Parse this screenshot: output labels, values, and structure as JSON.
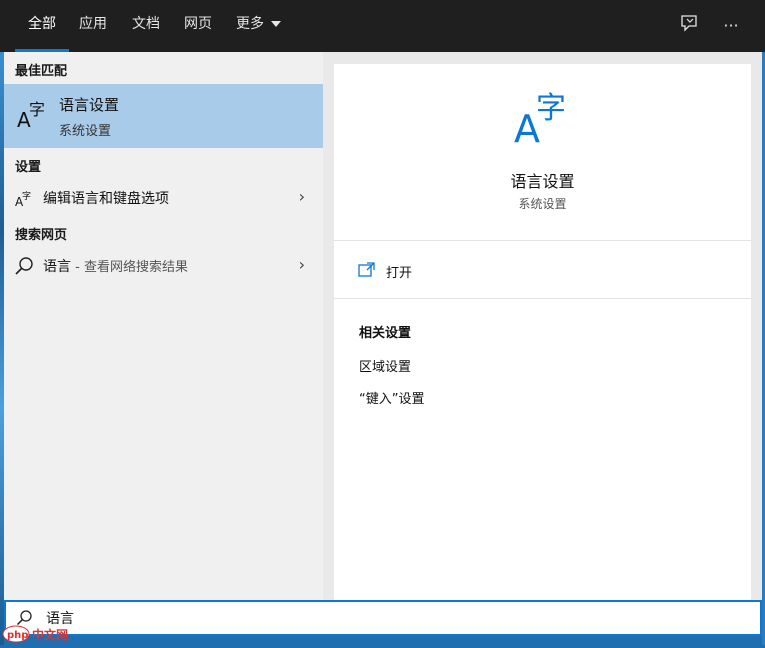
{
  "tabs": [
    {
      "label": "全部",
      "active": true
    },
    {
      "label": "应用",
      "active": false
    },
    {
      "label": "文档",
      "active": false
    },
    {
      "label": "网页",
      "active": false
    },
    {
      "label": "更多",
      "active": false
    }
  ],
  "tabs_more_icon": "caret-down-icon",
  "topbar_icons": [
    "feedback-icon",
    "more-options-icon"
  ],
  "topbar_more_glyph": "···",
  "left": {
    "best_match_header": "最佳匹配",
    "best_match": {
      "title": "语言设置",
      "subtitle": "系统设置",
      "icon": "language-icon"
    },
    "settings_header": "设置",
    "settings_items": [
      {
        "label": "编辑语言和键盘选项",
        "icon": "language-small-icon"
      }
    ],
    "web_header": "搜索网页",
    "web_item": {
      "query": "语言",
      "suffix": " - 查看网络搜索结果",
      "icon": "search-icon"
    }
  },
  "right": {
    "title": "语言设置",
    "subtitle": "系统设置",
    "icon": "language-icon",
    "action_open": "打开",
    "related_header": "相关设置",
    "related_links": [
      "区域设置",
      "“键入”设置"
    ]
  },
  "search": {
    "value": "语言"
  },
  "watermark": {
    "text": "php 中文网"
  },
  "colors": {
    "accent": "#0b78d4",
    "topbar": "#1f1f1f",
    "selected": "#a9cbea"
  }
}
